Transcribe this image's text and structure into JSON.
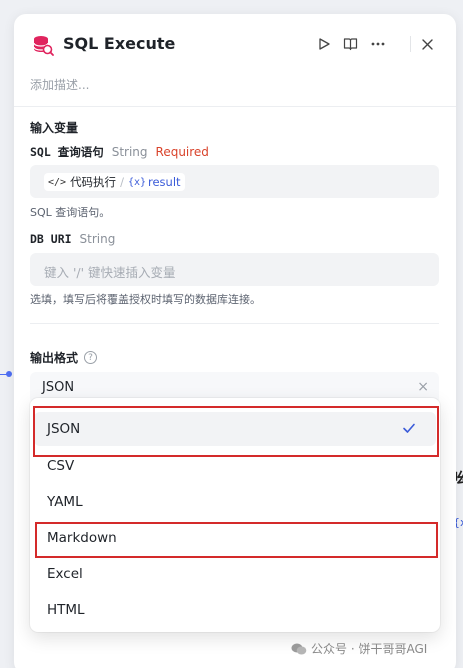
{
  "node": {
    "title": "SQL Execute",
    "description_placeholder": "添加描述...",
    "actions": [
      "run-icon",
      "docs-icon",
      "more-icon",
      "close-icon"
    ]
  },
  "inputs": {
    "section_title": "输入变量",
    "sql_query": {
      "name": "SQL 查询语句",
      "type": "String",
      "required": "Required",
      "chip_source": "代码执行",
      "chip_var": "{x}",
      "chip_value": "result",
      "help": "SQL 查询语句。"
    },
    "db_uri": {
      "name": "DB URI",
      "type": "String",
      "placeholder": "键入 '/' 键快速插入变量",
      "help": "选填，填写后将覆盖授权时填写的数据库连接。"
    }
  },
  "output_format": {
    "title": "输出格式",
    "help_icon": "?",
    "selected": "JSON",
    "clear_icon": "×",
    "options": [
      "JSON",
      "CSV",
      "YAML",
      "Markdown",
      "Excel",
      "HTML"
    ]
  },
  "background": {
    "right_text": "吆",
    "right_chip": "{x}",
    "arrow": "›"
  },
  "watermark": {
    "text": "公众号 · 饼干哥哥AGI"
  },
  "colors": {
    "accent": "#3a5bd9",
    "required": "#d9432b",
    "highlight_box": "#d42a2a",
    "icon_pink": "#e0245e"
  }
}
